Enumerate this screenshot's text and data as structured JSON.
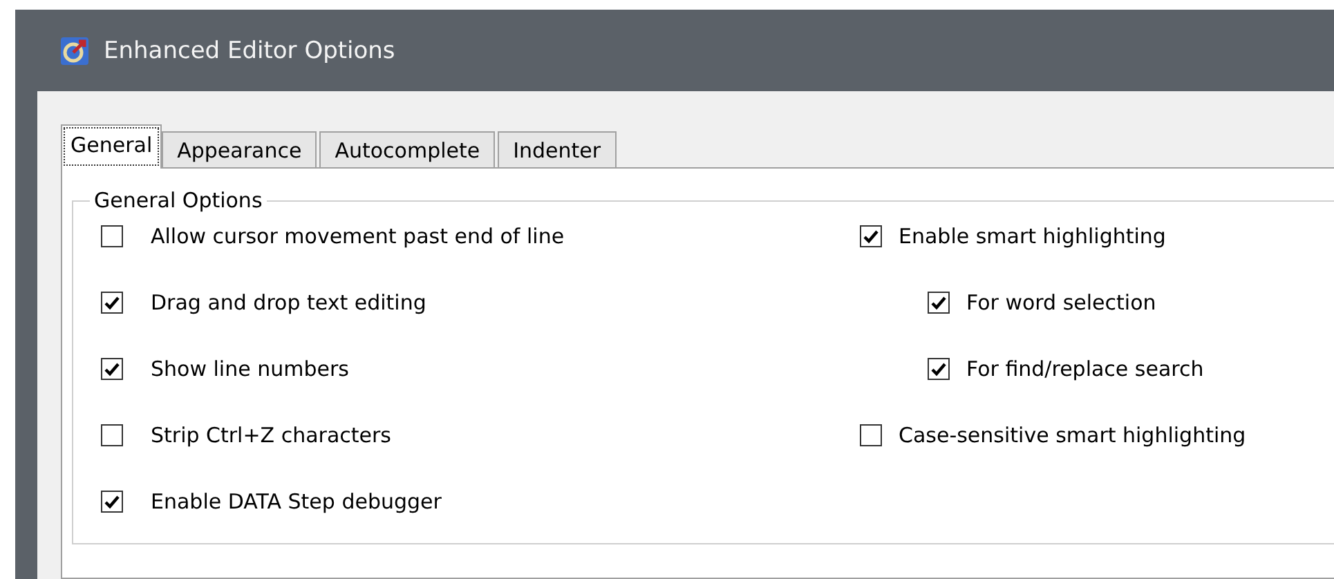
{
  "window": {
    "title": "Enhanced Editor Options"
  },
  "tabs": [
    {
      "label": "General",
      "selected": true
    },
    {
      "label": "Appearance",
      "selected": false
    },
    {
      "label": "Autocomplete",
      "selected": false
    },
    {
      "label": "Indenter",
      "selected": false
    }
  ],
  "group": {
    "legend": "General Options",
    "left": [
      {
        "label": "Allow cursor movement past end of line",
        "checked": false
      },
      {
        "label": "Drag and drop text editing",
        "checked": true
      },
      {
        "label": "Show line numbers",
        "checked": true
      },
      {
        "label": "Strip Ctrl+Z characters",
        "checked": false
      },
      {
        "label": "Enable DATA Step debugger",
        "checked": true
      }
    ],
    "right": [
      {
        "label": "Enable smart highlighting",
        "checked": true,
        "children": [
          {
            "label": "For word selection",
            "checked": true
          },
          {
            "label": "For find/replace search",
            "checked": true
          }
        ]
      },
      {
        "label": "Case-sensitive smart highlighting",
        "checked": false
      }
    ]
  }
}
